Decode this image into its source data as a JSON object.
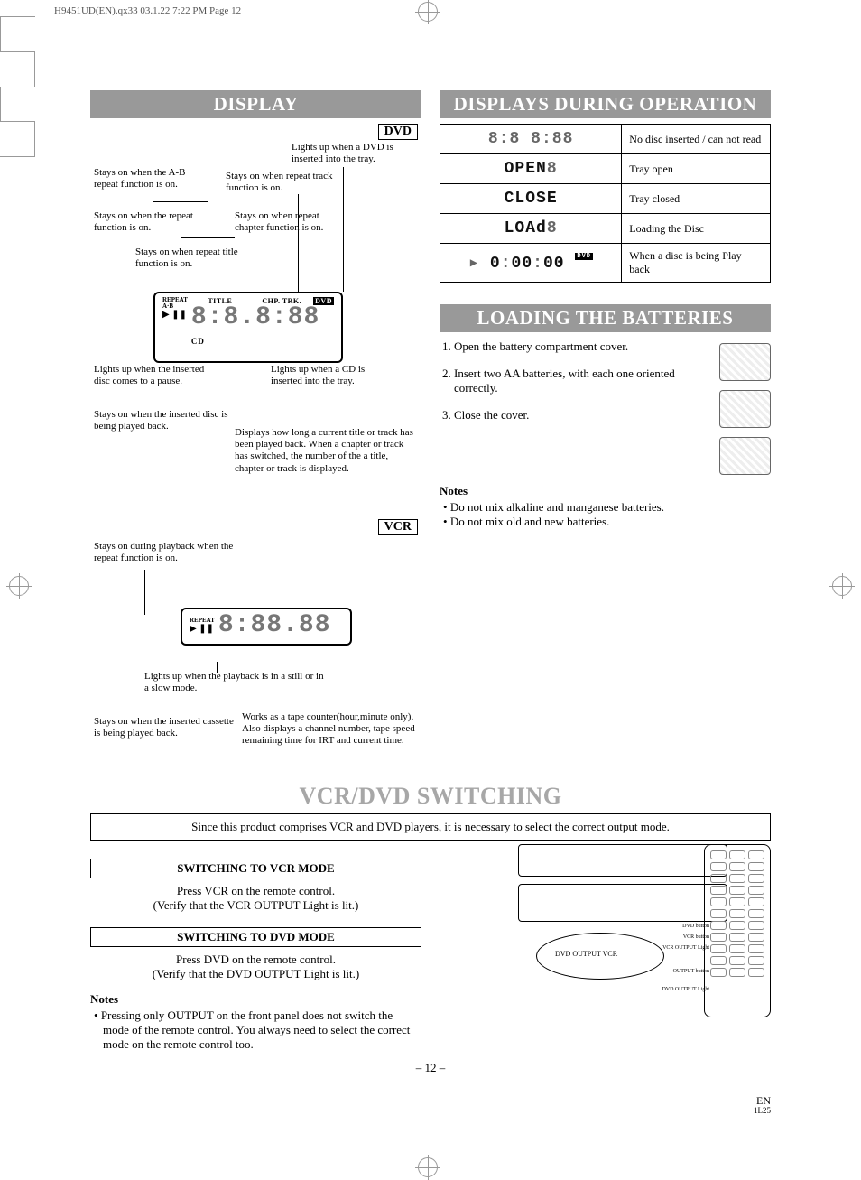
{
  "header_strip": "H9451UD(EN).qx33  03.1.22 7:22 PM  Page 12",
  "left": {
    "title": "DISPLAY",
    "dvd_tag": "DVD",
    "dvd_callouts": {
      "insert": "Lights up when a DVD is inserted into the tray.",
      "ab": "Stays on when the A-B repeat function is on.",
      "rpt_track": "Stays on when repeat track function is on.",
      "rpt": "Stays on when the repeat function is on.",
      "rpt_chap": "Stays on when repeat chapter function is on.",
      "rpt_title": "Stays on when repeat title function is on.",
      "pause": "Lights up when the inserted disc comes to a pause.",
      "playing": "Stays on when the inserted disc is being played back.",
      "cd": "Lights up when a CD is inserted into the tray.",
      "counter": "Displays how long a current title or track has been played back. When a chapter or track has switched, the number of the a title, chapter or track is displayed."
    },
    "lcd_labels": {
      "repeat": "REPEAT",
      "ab": "A·B",
      "title": "TITLE",
      "chptrk": "CHP. TRK.",
      "dvd": "DVD",
      "cd": "CD"
    },
    "vcr_tag": "VCR",
    "vcr_callouts": {
      "rpt": "Stays on during playback when the repeat function is on.",
      "still": "Lights up when the playback is in a still or in a slow mode.",
      "playing": "Stays on when the inserted cassette is being played back.",
      "counter": "Works as a tape counter(hour,minute only). Also displays a channel number, tape speed remaining time for IRT and current time."
    }
  },
  "right": {
    "title1": "DISPLAYS DURING OPERATION",
    "op_rows": [
      {
        "display": "8:8 8:8 8",
        "desc": "No disc inserted / can not read"
      },
      {
        "display": "OPEN",
        "desc": "Tray open"
      },
      {
        "display": "CLOSE",
        "desc": "Tray closed"
      },
      {
        "display": "LOAd",
        "desc": "Loading the Disc"
      },
      {
        "display": "0:00:00",
        "desc": "When a disc is being Play back"
      }
    ],
    "title2": "LOADING THE BATTERIES",
    "steps": [
      "Open the battery compartment cover.",
      "Insert two AA batteries, with each one oriented correctly.",
      "Close the cover."
    ],
    "notes_head": "Notes",
    "notes": [
      "Do not mix alkaline and manganese batteries.",
      "Do not mix old and new batteries."
    ]
  },
  "switching": {
    "big_title": "VCR/DVD SWITCHING",
    "intro": "Since this product comprises VCR and DVD players, it is necessary to select the correct output mode.",
    "vcr_head": "SWITCHING TO VCR MODE",
    "vcr_body1": "Press VCR on the remote control.",
    "vcr_body2": "(Verify that the VCR OUTPUT Light is lit.)",
    "dvd_head": "SWITCHING TO DVD MODE",
    "dvd_body1": "Press DVD on the remote control.",
    "dvd_body2": "(Verify that the DVD OUTPUT Light is lit.)",
    "notes_head": "Notes",
    "note1": "Pressing only OUTPUT on the front panel does not switch the mode of the remote control. You always need to select the correct mode on the remote control too.",
    "panel_labels": {
      "dvd_out": "DVD OUTPUT VCR",
      "dvd_btn": "DVD button",
      "vcr_btn": "VCR button",
      "vcr_light": "VCR OUTPUT Light",
      "out_btn": "OUTPUT button",
      "dvd_light": "DVD OUTPUT Light"
    }
  },
  "footer": {
    "page": "– 12 –",
    "right1": "EN",
    "right2": "1L25"
  }
}
